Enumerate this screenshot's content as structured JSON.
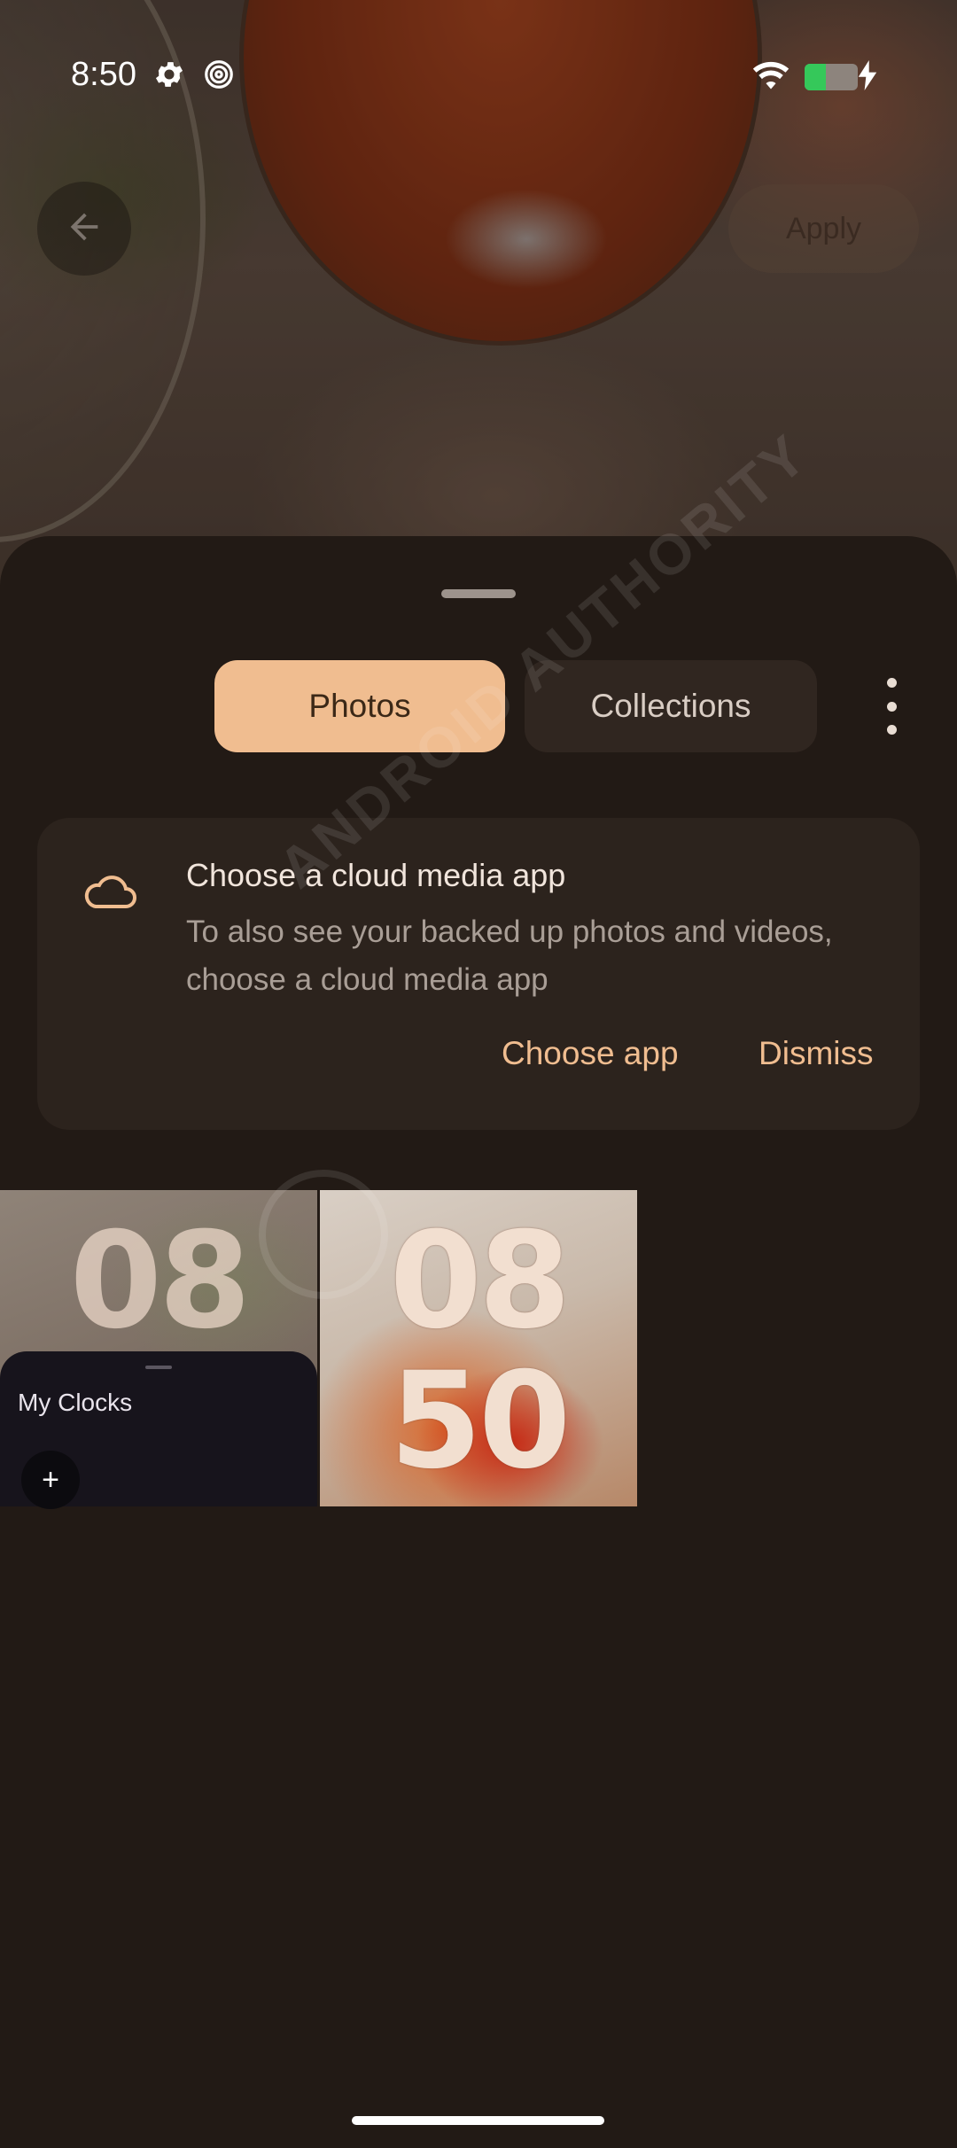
{
  "status_bar": {
    "time": "8:50",
    "icons": [
      "gear-icon",
      "spiral-icon",
      "wifi-icon",
      "battery-icon",
      "charging-bolt-icon"
    ],
    "battery_level": 0.4,
    "battery_color": "#35c85a"
  },
  "top_actions": {
    "back_icon": "arrow-left-icon",
    "apply_label": "Apply"
  },
  "tabs": [
    {
      "label": "Photos",
      "selected": true
    },
    {
      "label": "Collections",
      "selected": false
    }
  ],
  "more_icon": "more-vert-icon",
  "cloud_card": {
    "icon": "cloud-icon",
    "title": "Choose a cloud media app",
    "body": "To also see your backed up photos and videos, choose a cloud media app",
    "primary_action": "Choose app",
    "secondary_action": "Dismiss"
  },
  "thumbnails": [
    {
      "digits": [
        "08"
      ],
      "overlay_title": "My Clocks",
      "overlay_button": "+"
    },
    {
      "digits": [
        "08",
        "50"
      ]
    }
  ],
  "watermark_text": "ANDROID AUTHORITY",
  "colors": {
    "accent": "#f0bd90",
    "sheet_bg": "#221a15",
    "card_bg": "#2c231d"
  }
}
